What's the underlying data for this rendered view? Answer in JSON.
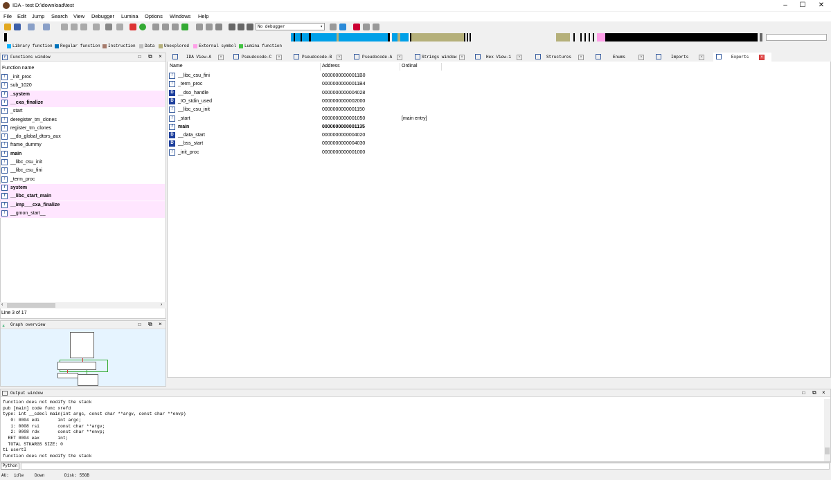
{
  "window": {
    "title": "IDA - test D:\\download\\test",
    "controls": [
      "–",
      "☐",
      "✕"
    ]
  },
  "menu": [
    "File",
    "Edit",
    "Jump",
    "Search",
    "View",
    "Debugger",
    "Lumina",
    "Options",
    "Windows",
    "Help"
  ],
  "toolbar": {
    "debugger_select": "No debugger"
  },
  "legend": [
    {
      "label": "Library function",
      "color": "#00b0ff"
    },
    {
      "label": "Regular function",
      "color": "#0072bb"
    },
    {
      "label": "Instruction",
      "color": "#a57a6b"
    },
    {
      "label": "Data",
      "color": "#c0c0c0"
    },
    {
      "label": "Unexplored",
      "color": "#b5b07a"
    },
    {
      "label": "External symbol",
      "color": "#ff9fe8"
    },
    {
      "label": "Lumina function",
      "color": "#41c241"
    }
  ],
  "functions_window": {
    "title": "Functions window",
    "column": "Function name",
    "rows": [
      {
        "name": "_init_proc",
        "bold": false,
        "pink": false
      },
      {
        "name": "sub_1020",
        "bold": false,
        "pink": false
      },
      {
        "name": "_system",
        "bold": true,
        "pink": true
      },
      {
        "name": "__cxa_finalize",
        "bold": true,
        "pink": true
      },
      {
        "name": "_start",
        "bold": false,
        "pink": false
      },
      {
        "name": "deregister_tm_clones",
        "bold": false,
        "pink": false
      },
      {
        "name": "register_tm_clones",
        "bold": false,
        "pink": false
      },
      {
        "name": "__do_global_dtors_aux",
        "bold": false,
        "pink": false
      },
      {
        "name": "frame_dummy",
        "bold": false,
        "pink": false
      },
      {
        "name": "main",
        "bold": true,
        "pink": false
      },
      {
        "name": "__libc_csu_init",
        "bold": false,
        "pink": false
      },
      {
        "name": "__libc_csu_fini",
        "bold": false,
        "pink": false
      },
      {
        "name": "_term_proc",
        "bold": false,
        "pink": false
      },
      {
        "name": "system",
        "bold": true,
        "pink": true
      },
      {
        "name": "__libc_start_main",
        "bold": true,
        "pink": true
      },
      {
        "name": "__imp___cxa_finalize",
        "bold": true,
        "pink": true
      },
      {
        "name": "__gmon_start__",
        "bold": false,
        "pink": true
      }
    ],
    "line_info": "Line 3 of 17"
  },
  "graph_overview": {
    "title": "Graph overview"
  },
  "tabs": [
    {
      "label": "IDA View-A",
      "active": false
    },
    {
      "label": "Pseudocode-C",
      "active": false
    },
    {
      "label": "Pseudocode-B",
      "active": false
    },
    {
      "label": "Pseudocode-A",
      "active": false
    },
    {
      "label": "Strings window",
      "active": false
    },
    {
      "label": "Hex View-1",
      "active": false
    },
    {
      "label": "Structures",
      "active": false
    },
    {
      "label": "Enums",
      "active": false
    },
    {
      "label": "Imports",
      "active": false
    },
    {
      "label": "Exports",
      "active": true
    }
  ],
  "exports": {
    "columns": [
      "Name",
      "Address",
      "Ordinal"
    ],
    "rows": [
      {
        "icon": "f",
        "name": "__libc_csu_fini",
        "address": "00000000000011B0",
        "ordinal": "",
        "bold": false
      },
      {
        "icon": "f",
        "name": "_term_proc",
        "address": "00000000000011B4",
        "ordinal": "",
        "bold": false
      },
      {
        "icon": "D",
        "name": "__dso_handle",
        "address": "0000000000004028",
        "ordinal": "",
        "bold": false
      },
      {
        "icon": "D",
        "name": "_IO_stdin_used",
        "address": "0000000000002000",
        "ordinal": "",
        "bold": false
      },
      {
        "icon": "f",
        "name": "__libc_csu_init",
        "address": "0000000000001150",
        "ordinal": "",
        "bold": false
      },
      {
        "icon": "f",
        "name": "_start",
        "address": "0000000000001050",
        "ordinal": "[main entry]",
        "bold": false
      },
      {
        "icon": "f",
        "name": "main",
        "address": "0000000000001135",
        "ordinal": "",
        "bold": true
      },
      {
        "icon": "D",
        "name": "__data_start",
        "address": "0000000000004020",
        "ordinal": "",
        "bold": false
      },
      {
        "icon": "D",
        "name": "__bss_start",
        "address": "0000000000004030",
        "ordinal": "",
        "bold": false
      },
      {
        "icon": "f",
        "name": "_init_proc",
        "address": "0000000000001000",
        "ordinal": "",
        "bold": false
      }
    ]
  },
  "output": {
    "title": "Output window",
    "lines": [
      "function does not modify the stack",
      "pub [main] code func xrefd",
      "type: int __cdecl main(int argc, const char **argv, const char **envp)",
      "   0: 0004 edi       int argc;",
      "   1: 0008 rsi       const char **argv;",
      "   2: 0008 rdx       const char **envp;",
      "  RET 0004 eax       int;",
      "  TOTAL STKARGS SIZE: 0",
      "ti usertI",
      "function does not modify the stack"
    ]
  },
  "python_label": "Python",
  "status": {
    "au": "AU:",
    "state": "idle",
    "dir": "Down",
    "disk": "Disk: 55GB"
  }
}
